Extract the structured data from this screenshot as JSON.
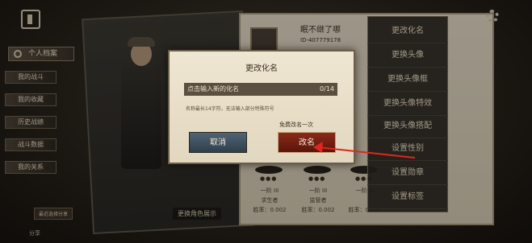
{
  "left_menu": {
    "profile_tab": "个人档案",
    "items": [
      "我的战斗",
      "我的收藏",
      "历史战绩",
      "战斗数据",
      "我的关系"
    ]
  },
  "character": {
    "change_view_label": "更换角色展示",
    "badge_label": "最近选择分享",
    "share_label": "分享"
  },
  "profile": {
    "username": "眠不继了哪",
    "uid": "ID-407779178",
    "stats": [
      {
        "rank": "一阶 III",
        "role": "求生者",
        "value": "胜率：0.002"
      },
      {
        "rank": "一阶 III",
        "role": "监管者",
        "value": "胜率：0.002"
      },
      {
        "rank": "一阶 III",
        "role": "",
        "value": "胜率：0.001"
      }
    ]
  },
  "right_menu": {
    "items": [
      "更改化名",
      "更换头像",
      "更换头像框",
      "更换头像特效",
      "更换头像搭配",
      "设置性别",
      "设置勋章",
      "设置标签"
    ]
  },
  "dialog": {
    "title": "更改化名",
    "input_placeholder": "点击输入新的化名",
    "char_count": "0/14",
    "hint": "名称最长14字符，无法输入部分特殊符号",
    "free_note": "免费改名一次",
    "cancel_label": "取消",
    "confirm_label": "改名"
  },
  "colors": {
    "confirm_button": "#7a2214",
    "cancel_button": "#3f5261",
    "annotation_arrow": "#e0261d"
  }
}
